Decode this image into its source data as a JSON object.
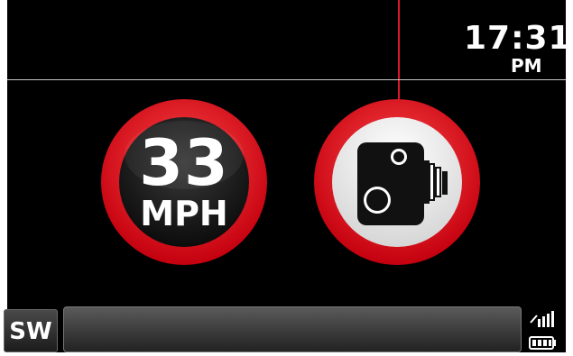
{
  "clock": {
    "time": "17:31",
    "ampm": "PM"
  },
  "speed_sign": {
    "value": "33",
    "unit": "MPH"
  },
  "camera_sign": {
    "icon": "speed-camera-icon"
  },
  "bottom": {
    "heading": "SW",
    "street": ""
  },
  "status": {
    "signal_icon": "signal-bars-icon",
    "battery_icon": "battery-icon"
  },
  "colors": {
    "accent": "#e0172a",
    "background": "#000000"
  }
}
